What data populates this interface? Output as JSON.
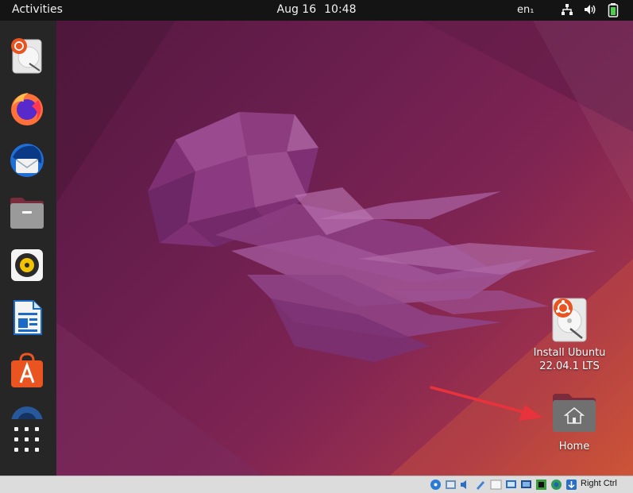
{
  "topbar": {
    "activities": "Activities",
    "date": "Aug 16",
    "time": "10:48",
    "language": "en₁",
    "tray_icons": [
      "network-icon",
      "volume-icon",
      "battery-icon"
    ]
  },
  "dock": {
    "items": [
      {
        "name": "install-ubuntu-icon"
      },
      {
        "name": "firefox-icon"
      },
      {
        "name": "thunderbird-icon"
      },
      {
        "name": "files-icon"
      },
      {
        "name": "rhythmbox-icon"
      },
      {
        "name": "libreoffice-writer-icon"
      },
      {
        "name": "app-center-icon"
      },
      {
        "name": "help-icon"
      },
      {
        "name": "show-apps-icon"
      }
    ]
  },
  "desktop": {
    "icons": [
      {
        "label_line1": "Install Ubuntu",
        "label_line2": "22.04.1 LTS",
        "icon": "install-disc-icon"
      },
      {
        "label": "Home",
        "icon": "home-folder-icon"
      }
    ],
    "annotation": {
      "type": "arrow",
      "color": "#e8323c",
      "points_to": "Home"
    }
  },
  "vbox_statusbar": {
    "icons": [
      "hard-disk-icon",
      "optical-drive-icon",
      "audio-icon",
      "network-adapter-icon",
      "usb-icon",
      "shared-folder-icon",
      "display-icon",
      "recording-icon",
      "cpu-icon",
      "mouse-integration-icon",
      "keyboard-icon"
    ],
    "host_key": "Right Ctrl"
  },
  "colors": {
    "topbar": "#141414",
    "dock": "#262626",
    "wallpaper_dark": "#55183f",
    "wallpaper_light": "#c95235",
    "arrow": "#e8323c"
  }
}
